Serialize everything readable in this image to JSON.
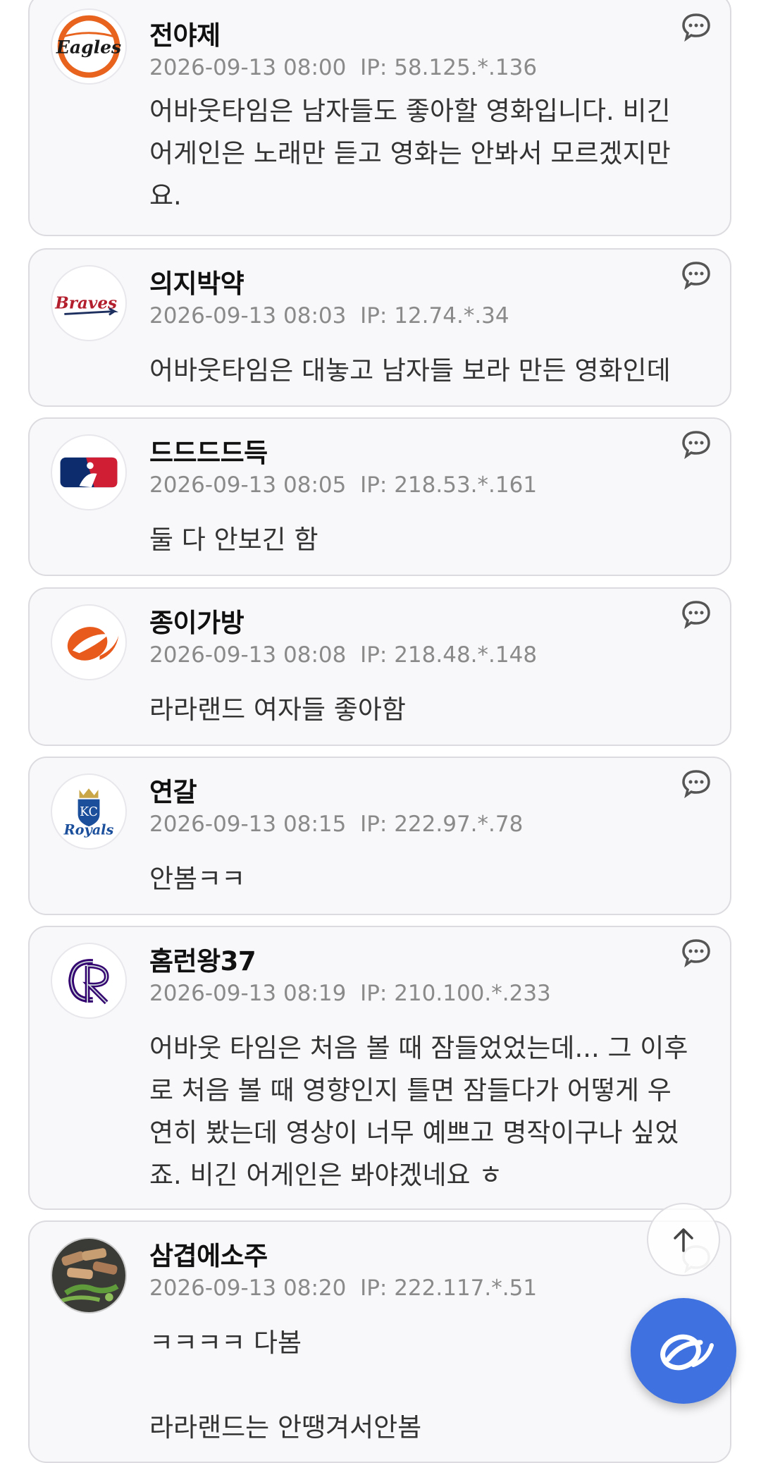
{
  "comments": [
    {
      "nick": "전야제",
      "date": "2026-09-13 08:00",
      "ip": "IP: 58.125.*.136",
      "body": "어바웃타임은 남자들도 좋아할 영화입니다. 비긴\n어게인은 노래만 듣고 영화는 안봐서 모르겠지만\n요.",
      "avatar_icon": "eagles-logo",
      "avatar_logo_text": "Eagles"
    },
    {
      "nick": "의지박약",
      "date": "2026-09-13 08:03",
      "ip": "IP: 12.74.*.34",
      "body": "어바웃타임은 대놓고 남자들 보라 만든 영화인데",
      "avatar_icon": "braves-logo",
      "avatar_logo_text": "Braves"
    },
    {
      "nick": "드드드드득",
      "date": "2026-09-13 08:05",
      "ip": "IP: 218.53.*.161",
      "body": "둘 다 안보긴 함",
      "avatar_icon": "mlb-logo"
    },
    {
      "nick": "종이가방",
      "date": "2026-09-13 08:08",
      "ip": "IP: 218.48.*.148",
      "body": "라라랜드 여자들 좋아함",
      "avatar_icon": "baseball-swoosh-logo"
    },
    {
      "nick": "연갈",
      "date": "2026-09-13 08:15",
      "ip": "IP: 222.97.*.78",
      "body": "안봄ㅋㅋ",
      "avatar_icon": "royals-logo",
      "avatar_logo_text": "Royals"
    },
    {
      "nick": "홈런왕37",
      "date": "2026-09-13 08:19",
      "ip": "IP: 210.100.*.233",
      "body": "어바웃 타임은 처음 볼 때 잠들었었는데... 그 이후\n로 처음 볼 때 영향인지 틀면 잠들다가 어떻게 우\n연히 봤는데 영상이 너무 예쁘고 명작이구나 싶었\n죠. 비긴 어게인은 봐야겠네요 ㅎ",
      "avatar_icon": "rockies-logo"
    },
    {
      "nick": "삼겹에소주",
      "date": "2026-09-13 08:20",
      "ip": "IP: 222.117.*.51",
      "body": "ㅋㅋㅋㅋ 다봄\n\n라라랜드는 안땡겨서안봄",
      "avatar_icon": "grilled-pork-photo"
    }
  ],
  "icons": {
    "reply": "speech-bubble-icon",
    "scroll_top": "arrow-up-icon",
    "write": "baseball-swoosh-icon"
  },
  "colors": {
    "fab": "#3f72e0",
    "card_bg": "#f8f8fa",
    "meta": "#8a8a8a"
  }
}
